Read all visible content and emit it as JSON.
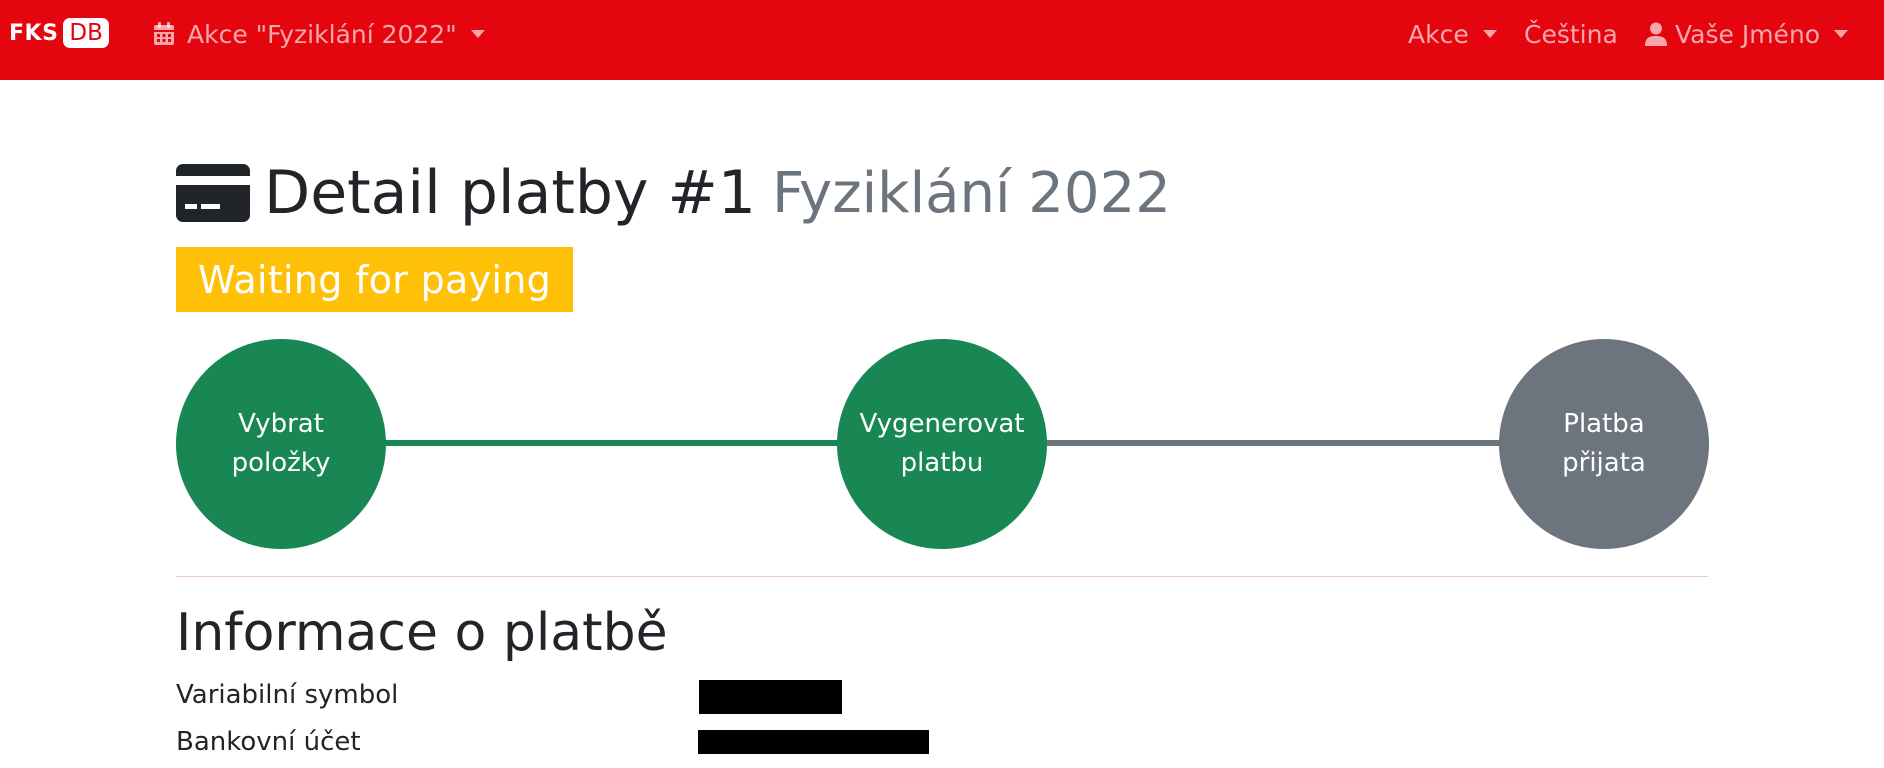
{
  "navbar": {
    "brand_fks": "FKS",
    "brand_db": "DB",
    "event_selector": "Akce \"Fyziklání 2022\"",
    "akce_menu": "Akce",
    "language": "Čeština",
    "user_menu": "Vaše Jméno"
  },
  "page": {
    "title": "Detail platby #1",
    "subtitle": "Fyziklání 2022",
    "status_badge": "Waiting for paying",
    "status_color": "#ffc107"
  },
  "steps": [
    {
      "label": "Vybrat položky",
      "state": "done",
      "color": "#198754"
    },
    {
      "label": "Vygenerovat platbu",
      "state": "done",
      "color": "#198754"
    },
    {
      "label": "Platba přijata",
      "state": "pending",
      "color": "#6c757d"
    }
  ],
  "info": {
    "heading": "Informace o platbě",
    "variable_symbol_label": "Variabilní symbol",
    "bank_account_label": "Bankovní účet"
  },
  "icons": {
    "event": "calendar-icon",
    "user": "user-icon",
    "title": "credit-card-icon"
  },
  "colors": {
    "navbar": "#e4050f",
    "success": "#198754",
    "secondary": "#6c757d"
  }
}
